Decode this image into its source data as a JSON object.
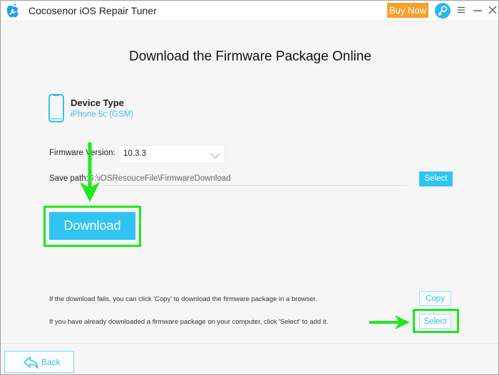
{
  "window": {
    "title": "Cocosenor iOS Repair Tuner",
    "buy_label": "Buy Now",
    "icons": {
      "app": "app-logo-icon",
      "register": "key-icon",
      "menu": "menu-icon",
      "minimize": "minimize-icon",
      "close": "close-icon"
    }
  },
  "main": {
    "title": "Download the Firmware Package Online",
    "device": {
      "label": "Device Type",
      "value": "iPhone 5c (GSM)"
    },
    "firmware": {
      "label": "Firmware Version:",
      "selected": "10.3.3"
    },
    "save_path": {
      "label": "Save path:",
      "value": "G:\\iOSResouceFile\\FirmwareDownload",
      "select_label": "Select"
    },
    "download_label": "Download",
    "hints": [
      {
        "text": "If the download fails, you can click 'Copy' to download the firmware package in a browser.",
        "button": "Copy"
      },
      {
        "text": "If you have already downloaded a firmware package on your computer, click 'Select' to add it.",
        "button": "Select"
      }
    ]
  },
  "footer": {
    "back_label": "Back"
  },
  "colors": {
    "accent": "#2fc4f2",
    "buy": "#f7a12d",
    "highlight": "#1ee81e"
  }
}
